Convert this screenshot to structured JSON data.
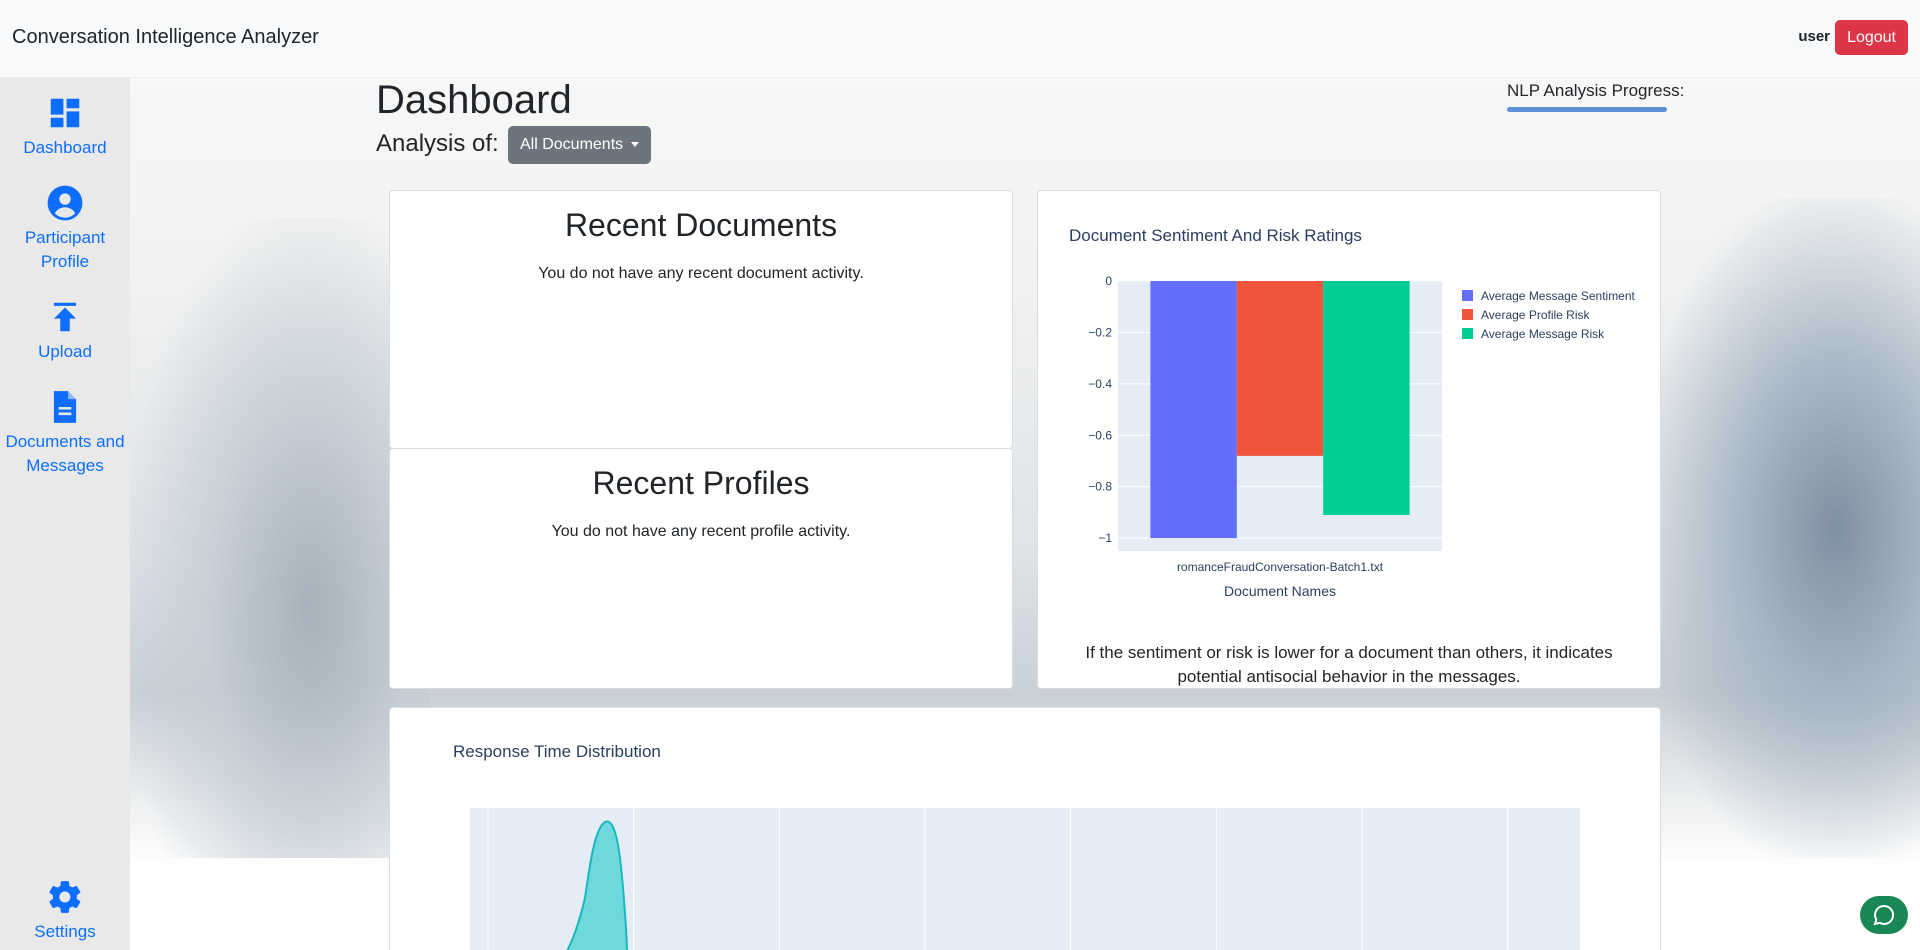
{
  "app": {
    "title": "Conversation Intelligence Analyzer"
  },
  "header": {
    "user": "user",
    "logout_label": "Logout"
  },
  "sidebar": {
    "items": [
      {
        "label": "Dashboard",
        "icon": "dashboard-icon"
      },
      {
        "label": "Participant Profile",
        "icon": "person-icon"
      },
      {
        "label": "Upload",
        "icon": "upload-icon"
      },
      {
        "label": "Documents and Messages",
        "icon": "document-icon"
      }
    ],
    "settings_label": "Settings"
  },
  "page": {
    "title": "Dashboard",
    "analysis_label": "Analysis of:",
    "document_selected": "All Documents",
    "progress_label": "NLP Analysis Progress:",
    "progress_value": 1.0
  },
  "recent_documents": {
    "title": "Recent Documents",
    "message": "You do not have any recent document activity."
  },
  "recent_profiles": {
    "title": "Recent Profiles",
    "message": "You do not have any recent profile activity."
  },
  "sentiment_card": {
    "note": "If the sentiment or risk is lower for a document than others, it indicates potential antisocial behavior in the messages."
  },
  "colors": {
    "accent": "#0d6efd",
    "danger": "#dc3545",
    "secondary": "#6c757d",
    "success": "#198754"
  },
  "chart_data": [
    {
      "type": "bar",
      "title": "Document Sentiment And Risk Ratings",
      "xlabel": "Document Names",
      "ylabel": "",
      "categories": [
        "romanceFraudConversation-Batch1.txt"
      ],
      "series": [
        {
          "name": "Average Message Sentiment",
          "color": "#636efa",
          "values": [
            -1.0
          ]
        },
        {
          "name": "Average Profile Risk",
          "color": "#ef553b",
          "values": [
            -0.68
          ]
        },
        {
          "name": "Average Message Risk",
          "color": "#00cc96",
          "values": [
            -0.91
          ]
        }
      ],
      "ylim": [
        -1.05,
        0
      ],
      "yticks": [
        "0",
        "−0.2",
        "−0.4",
        "−0.6",
        "−0.8",
        "−1"
      ],
      "ytick_values": [
        0,
        -0.2,
        -0.4,
        -0.6,
        -0.8,
        -1
      ],
      "legend": "top-right",
      "grid": true
    },
    {
      "type": "area",
      "title": "Response Time Distribution",
      "legend": "none",
      "grid": true
    }
  ]
}
